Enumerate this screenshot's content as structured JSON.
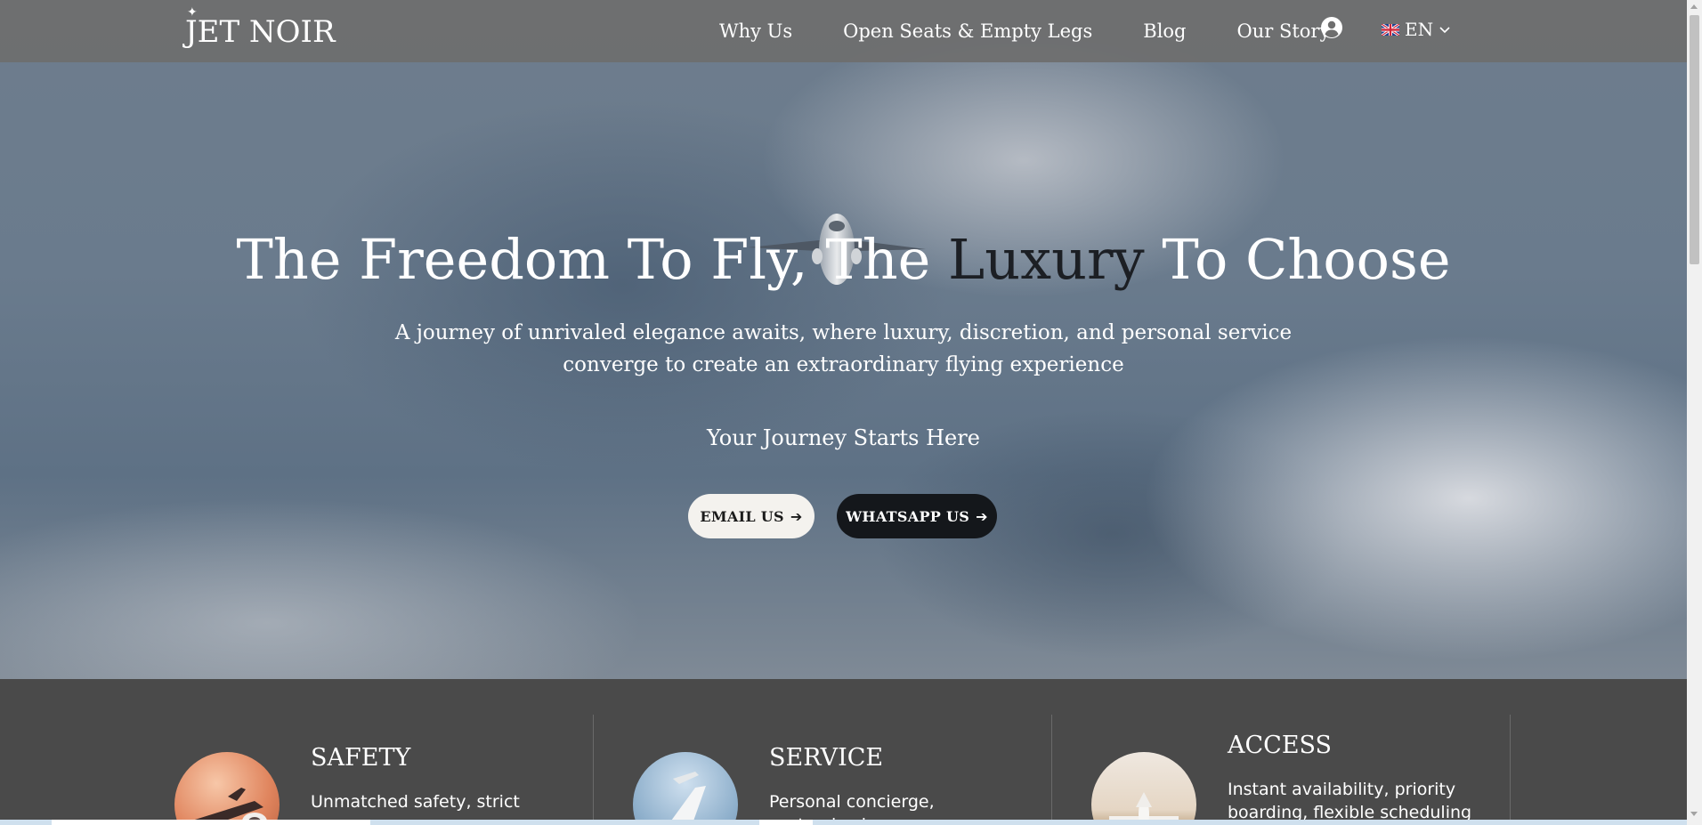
{
  "header": {
    "logo_text": "JET NOIR",
    "nav": [
      "Why Us",
      "Open Seats & Empty Legs",
      "Blog",
      "Our Story"
    ],
    "user_icon": "user-circle-icon",
    "language": "EN"
  },
  "hero": {
    "title_part1": "The Freedom To Fly, The ",
    "title_highlight": "Luxury",
    "title_part2": " To Choose",
    "subtitle": "A journey of unrivaled elegance awaits, where luxury, discretion, and personal service converge to create an extraordinary flying experience",
    "tagline": "Your Journey Starts Here",
    "email_button": "EMAIL US",
    "whatsapp_button": "WHATSAPP US"
  },
  "features": [
    {
      "title": "SAFETY",
      "text": "Unmatched safety, strict"
    },
    {
      "title": "SERVICE",
      "text": "Personal concierge, customized"
    },
    {
      "title": "ACCESS",
      "text": "Instant availability, priority boarding, flexible scheduling"
    }
  ],
  "colors": {
    "header_bg": "#6e6e6e",
    "features_bg": "#4a4a4a",
    "dark_button": "#14171b",
    "light_button": "#f4f2ee",
    "highlight_text": "#1c1f24"
  }
}
